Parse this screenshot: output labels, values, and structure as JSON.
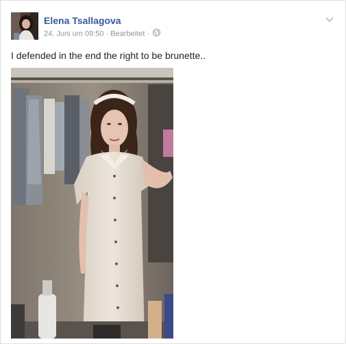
{
  "post": {
    "author": "Elena Tsallagova",
    "date": "24. Juni um 09:50",
    "separator": " · ",
    "edited": "Bearbeitet",
    "separator2": " · ",
    "text": "I defended in the end the right to be brunette..",
    "privacy_icon": "globe-icon",
    "menu_icon": "chevron-down-icon"
  },
  "colors": {
    "author_link": "#365899",
    "meta_text": "#90949c",
    "body_text": "#1d2129",
    "card_border": "#dddfe2"
  }
}
